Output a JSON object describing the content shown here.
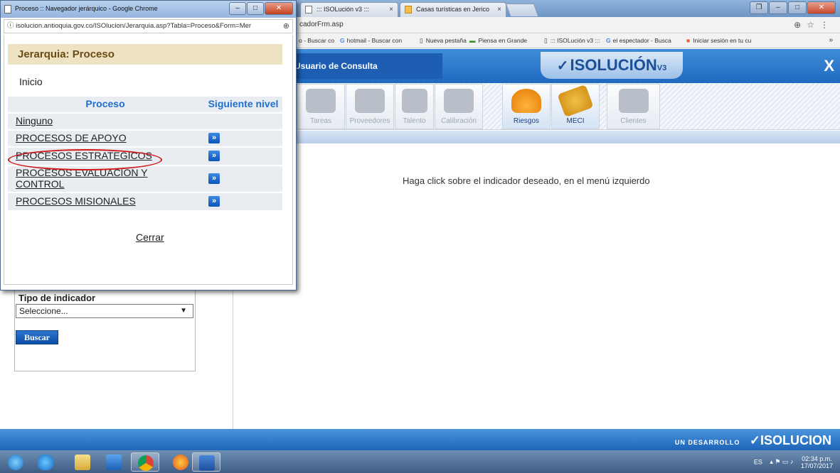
{
  "popup": {
    "window_title": "Proceso :: Navegador jerárquico - Google Chrome",
    "url": "isolucion.antioquia.gov.co/ISOlucion/Jerarquia.asp?Tabla=Proceso&Form=Mer",
    "heading": "Jerarquia: Proceso",
    "inicio_label": "Inicio",
    "table": {
      "col_proceso": "Proceso",
      "col_siguiente": "Siguiente nivel",
      "rows": [
        {
          "label": "Ninguno",
          "has_next": false
        },
        {
          "label": "PROCESOS DE APOYO",
          "has_next": true
        },
        {
          "label": "PROCESOS ESTRATEGICOS",
          "has_next": true
        },
        {
          "label": "PROCESOS EVALUACION Y CONTROL",
          "has_next": true
        },
        {
          "label": "PROCESOS MISIONALES",
          "has_next": true
        }
      ],
      "next_glyph": "»"
    },
    "close_link": "Cerrar"
  },
  "browser": {
    "tabs": [
      {
        "title": "::: ISOLución v3 :::"
      },
      {
        "title": "Casas turísticas en Jerico"
      }
    ],
    "url_fragment": "cadorFrm.asp",
    "bookmarks": [
      "o - Buscar co",
      "hotmail - Buscar con",
      "Nueva pestaña",
      "Piensa en Grande",
      "::: ISOLución v3 :::",
      "el espectador - Busca",
      "Iniciar sesión en tu cu"
    ],
    "more": "»"
  },
  "app": {
    "user_label": "Usuario de Consulta",
    "logo_text": "ISOLUCIÓN",
    "logo_version": "V3",
    "modules": [
      {
        "label": "Tareas",
        "state": "faded"
      },
      {
        "label": "Proveedores",
        "state": "faded"
      },
      {
        "label": "Talento",
        "state": "faded"
      },
      {
        "label": "Calibración",
        "state": "faded"
      },
      {
        "label": "Riesgos",
        "state": "active"
      },
      {
        "label": "MECI",
        "state": "active"
      },
      {
        "label": "Clientes",
        "state": "faded"
      }
    ],
    "main_message": "Haga click sobre el indicador deseado, en el menú izquierdo",
    "filter": {
      "label": "Tipo de indicador",
      "select_value": "Seleccione...",
      "button": "Buscar"
    },
    "footer_brand_prefix": "UN DESARROLLO",
    "footer_brand": "ISOLUCION"
  },
  "taskbar": {
    "lang": "ES",
    "time": "02:34 p.m.",
    "date": "17/07/2017"
  },
  "colors": {
    "highlight": "#d11a1a",
    "header_blue": "#1f69c0",
    "link_blue": "#1d6fd1"
  }
}
